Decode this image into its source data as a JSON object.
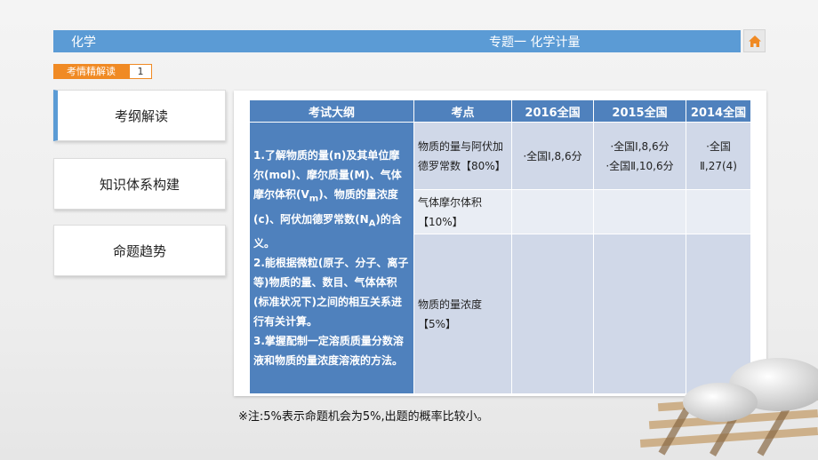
{
  "header": {
    "subject": "化学",
    "topic": "专题一  化学计量"
  },
  "tagline": {
    "label": "考情精解读",
    "number": "1"
  },
  "nav": [
    "考纲解读",
    "知识体系构建",
    "命题趋势"
  ],
  "table": {
    "headers": [
      "考试大纲",
      "考点",
      "2016全国",
      "2015全国",
      "2014全国"
    ],
    "outline": [
      "1.了解物质的量(n)及其单位摩尔(mol)、摩尔质量(M)、气体摩尔体积(V",
      "m",
      ")、物质的量浓度(c)、阿伏加德罗常数(N",
      "A",
      ")的含义。",
      "2.能根据微粒(原子、分子、离子等)物质的量、数目、气体体积(标准状况下)之间的相互关系进行有关计算。",
      "3.掌握配制一定溶质质量分数溶液和物质的量浓度溶液的方法。"
    ],
    "rows": [
      {
        "point": "物质的量与阿伏加德罗常数【80%】",
        "y2016": "·全国Ⅰ,8,6分",
        "y2015": "·全国Ⅰ,8,6分\n·全国Ⅱ,10,6分",
        "y2014": "·全国\nⅡ,27(4)"
      },
      {
        "point": "气体摩尔体积【10%】",
        "y2016": "",
        "y2015": "",
        "y2014": ""
      },
      {
        "point": "物质的量浓度【5%】",
        "y2016": "",
        "y2015": "",
        "y2014": ""
      }
    ]
  },
  "note": "※注:5%表示命题机会为5%,出题的概率比较小。",
  "colors": {
    "topbar": "#5b9bd5",
    "table_header": "#4f81bd",
    "tag": "#f08a24"
  },
  "icons": {
    "home": "home-icon"
  }
}
